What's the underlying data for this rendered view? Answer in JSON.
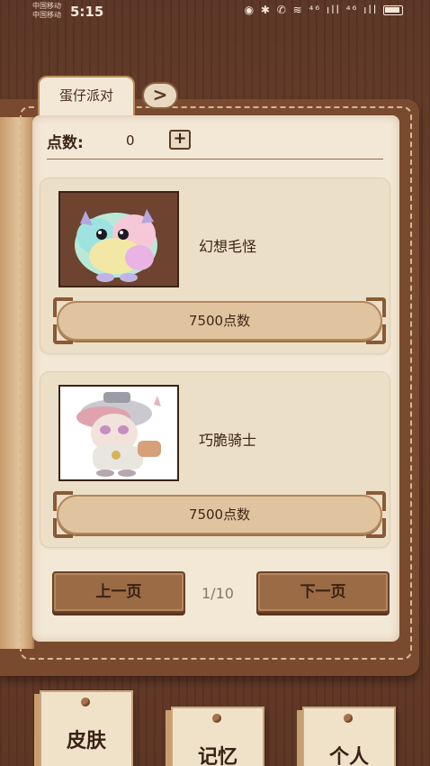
{
  "status_bar": {
    "carrier_line1": "中国移动",
    "carrier_line2": "中国移动",
    "time": "5:15",
    "icons": "◉ ✱ ✆ ≋ ⁴⁶ ıll ⁴⁶ ıll"
  },
  "header": {
    "tab_title": "蛋仔派对",
    "next_tab_label": ">"
  },
  "points": {
    "label": "点数:",
    "value": "0",
    "add_label": "+"
  },
  "items": [
    {
      "name": "幻想毛怪",
      "price": "7500点数"
    },
    {
      "name": "巧脆骑士",
      "price": "7500点数"
    }
  ],
  "pagination": {
    "prev_label": "上一页",
    "indicator": "1/10",
    "next_label": "下一页"
  },
  "bottom_nav": {
    "skin": "皮肤",
    "memory": "记忆",
    "profile": "个人"
  }
}
